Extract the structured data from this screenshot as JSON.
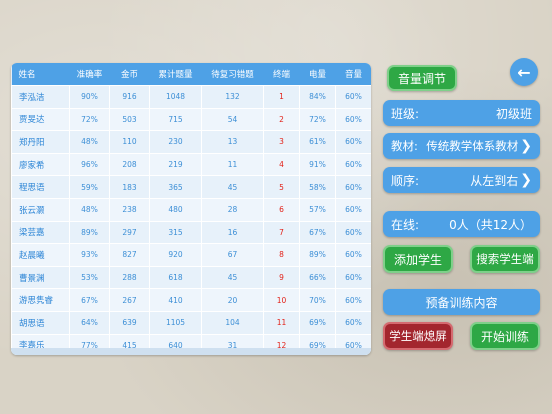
{
  "table": {
    "headers": [
      "姓名",
      "准确率",
      "金币",
      "累计题量",
      "待复习错题",
      "终端",
      "电量",
      "音量"
    ],
    "rows": [
      [
        "李泓洁",
        "90%",
        "916",
        "1048",
        "132",
        "1",
        "84%",
        "60%"
      ],
      [
        "贾旻达",
        "72%",
        "503",
        "715",
        "54",
        "2",
        "72%",
        "60%"
      ],
      [
        "郑丹阳",
        "48%",
        "110",
        "230",
        "13",
        "3",
        "61%",
        "60%"
      ],
      [
        "廖家希",
        "96%",
        "208",
        "219",
        "11",
        "4",
        "91%",
        "60%"
      ],
      [
        "程思语",
        "59%",
        "183",
        "365",
        "45",
        "5",
        "58%",
        "60%"
      ],
      [
        "张云灏",
        "48%",
        "238",
        "480",
        "28",
        "6",
        "57%",
        "60%"
      ],
      [
        "梁芸嘉",
        "89%",
        "297",
        "315",
        "16",
        "7",
        "67%",
        "60%"
      ],
      [
        "赵晨曦",
        "93%",
        "827",
        "920",
        "67",
        "8",
        "89%",
        "60%"
      ],
      [
        "曹景渊",
        "53%",
        "288",
        "618",
        "45",
        "9",
        "66%",
        "60%"
      ],
      [
        "游思隽睿",
        "67%",
        "267",
        "410",
        "20",
        "10",
        "70%",
        "60%"
      ],
      [
        "胡思语",
        "64%",
        "639",
        "1105",
        "104",
        "11",
        "69%",
        "60%"
      ],
      [
        "李嘉乐",
        "77%",
        "415",
        "640",
        "31",
        "12",
        "69%",
        "60%"
      ]
    ]
  },
  "controls": {
    "volume_label": "音量调节",
    "back_glyph": "←",
    "class_label": "班级:",
    "class_value": "初级班",
    "textbook_label": "教材:",
    "textbook_value": "传统教学体系教材",
    "order_label": "顺序:",
    "order_value": "从左到右",
    "online_label": "在线:",
    "online_value": "0人（共12人）",
    "add_student": "添加学生",
    "search_client": "搜索学生端",
    "prepare_training": "预备训练内容",
    "screen_off": "学生端熄屏",
    "start_training": "开始训练",
    "chevron_glyph": "❯"
  }
}
